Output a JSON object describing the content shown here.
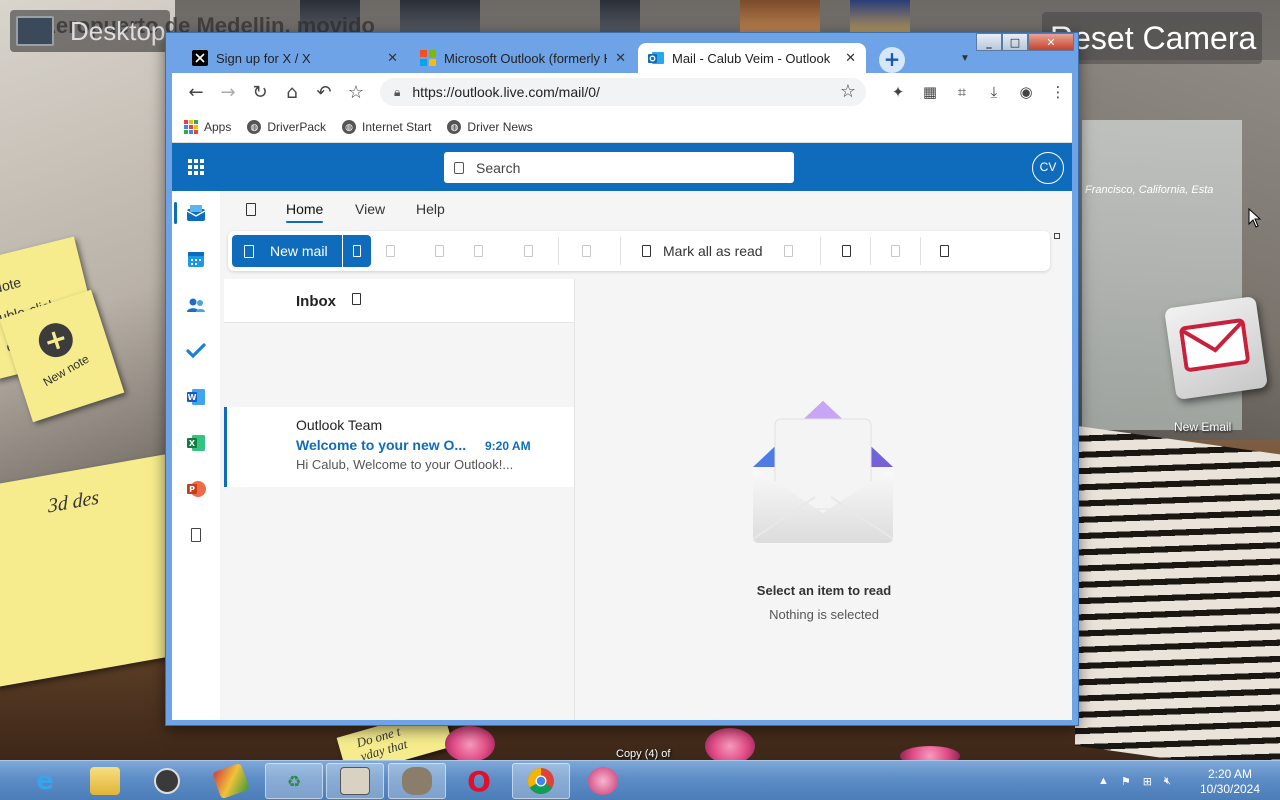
{
  "desktop": {
    "label": "Desktop",
    "reset_camera": "Reset Camera",
    "bg_left_text": "Aeropuerto de Medellin, movido",
    "bg_right_caption": "Francisco, California, Esta",
    "sticky_note1_text": "Note\nuble-click\ne",
    "new_note_label": "New note",
    "sticky_3d_text": "3d des",
    "sticky_bottom_text": "Do one t\nyday that",
    "new_email_label": "New Email",
    "copy_label": "Copy (4) of"
  },
  "window": {
    "controls": [
      "_",
      "□",
      "✕"
    ]
  },
  "tabs": [
    {
      "title": "Sign up for X / X",
      "favicon": "x-logo-icon",
      "active": false
    },
    {
      "title": "Microsoft Outlook (formerly H",
      "favicon": "microsoft-logo-icon",
      "active": false
    },
    {
      "title": "Mail - Calub Veim - Outlook",
      "favicon": "outlook-logo-icon",
      "active": true
    }
  ],
  "toolbar": {
    "url": "https://outlook.live.com/mail/0/"
  },
  "bookmarks": [
    {
      "label": "Apps",
      "icon": "apps-grid-icon"
    },
    {
      "label": "DriverPack",
      "icon": "globe-icon"
    },
    {
      "label": "Internet Start",
      "icon": "globe-icon"
    },
    {
      "label": "Driver News",
      "icon": "globe-icon"
    }
  ],
  "outlook": {
    "search_placeholder": "Search",
    "avatar_initials": "CV",
    "ribbon_tabs": [
      "Home",
      "View",
      "Help"
    ],
    "active_ribbon_tab": "Home",
    "new_mail_label": "New mail",
    "mark_all_read_label": "Mark all as read",
    "folder_title": "Inbox",
    "messages": [
      {
        "sender": "Outlook Team",
        "subject": "Welcome to your new O...",
        "time": "9:20 AM",
        "preview": "Hi Calub, Welcome to your Outlook!..."
      }
    ],
    "reading_pane": {
      "title": "Select an item to read",
      "subtitle": "Nothing is selected"
    },
    "rail_icons": [
      "mail-icon",
      "calendar-icon",
      "people-icon",
      "todo-icon",
      "word-icon",
      "excel-icon",
      "powerpoint-icon",
      "more-apps-icon"
    ]
  },
  "colors": {
    "outlook_blue": "#0f6cbd",
    "taskbar": "#5d8dc6"
  },
  "taskbar": {
    "apps": [
      "internet-explorer-icon",
      "file-explorer-icon",
      "media-player-icon",
      "winrar-icon",
      "recycle-icon",
      "device-icon",
      "gimp-icon",
      "opera-icon",
      "chrome-icon",
      "flower-app-icon"
    ],
    "clock_time": "2:20 AM",
    "clock_date": "10/30/2024"
  }
}
